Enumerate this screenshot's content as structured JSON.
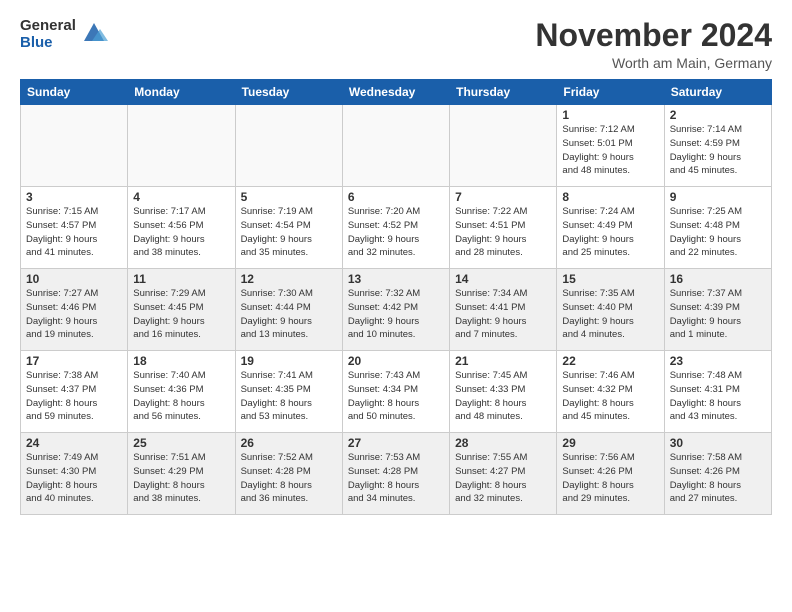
{
  "logo": {
    "general": "General",
    "blue": "Blue"
  },
  "title": "November 2024",
  "subtitle": "Worth am Main, Germany",
  "headers": [
    "Sunday",
    "Monday",
    "Tuesday",
    "Wednesday",
    "Thursday",
    "Friday",
    "Saturday"
  ],
  "weeks": [
    [
      {
        "day": "",
        "info": ""
      },
      {
        "day": "",
        "info": ""
      },
      {
        "day": "",
        "info": ""
      },
      {
        "day": "",
        "info": ""
      },
      {
        "day": "",
        "info": ""
      },
      {
        "day": "1",
        "info": "Sunrise: 7:12 AM\nSunset: 5:01 PM\nDaylight: 9 hours\nand 48 minutes."
      },
      {
        "day": "2",
        "info": "Sunrise: 7:14 AM\nSunset: 4:59 PM\nDaylight: 9 hours\nand 45 minutes."
      }
    ],
    [
      {
        "day": "3",
        "info": "Sunrise: 7:15 AM\nSunset: 4:57 PM\nDaylight: 9 hours\nand 41 minutes."
      },
      {
        "day": "4",
        "info": "Sunrise: 7:17 AM\nSunset: 4:56 PM\nDaylight: 9 hours\nand 38 minutes."
      },
      {
        "day": "5",
        "info": "Sunrise: 7:19 AM\nSunset: 4:54 PM\nDaylight: 9 hours\nand 35 minutes."
      },
      {
        "day": "6",
        "info": "Sunrise: 7:20 AM\nSunset: 4:52 PM\nDaylight: 9 hours\nand 32 minutes."
      },
      {
        "day": "7",
        "info": "Sunrise: 7:22 AM\nSunset: 4:51 PM\nDaylight: 9 hours\nand 28 minutes."
      },
      {
        "day": "8",
        "info": "Sunrise: 7:24 AM\nSunset: 4:49 PM\nDaylight: 9 hours\nand 25 minutes."
      },
      {
        "day": "9",
        "info": "Sunrise: 7:25 AM\nSunset: 4:48 PM\nDaylight: 9 hours\nand 22 minutes."
      }
    ],
    [
      {
        "day": "10",
        "info": "Sunrise: 7:27 AM\nSunset: 4:46 PM\nDaylight: 9 hours\nand 19 minutes."
      },
      {
        "day": "11",
        "info": "Sunrise: 7:29 AM\nSunset: 4:45 PM\nDaylight: 9 hours\nand 16 minutes."
      },
      {
        "day": "12",
        "info": "Sunrise: 7:30 AM\nSunset: 4:44 PM\nDaylight: 9 hours\nand 13 minutes."
      },
      {
        "day": "13",
        "info": "Sunrise: 7:32 AM\nSunset: 4:42 PM\nDaylight: 9 hours\nand 10 minutes."
      },
      {
        "day": "14",
        "info": "Sunrise: 7:34 AM\nSunset: 4:41 PM\nDaylight: 9 hours\nand 7 minutes."
      },
      {
        "day": "15",
        "info": "Sunrise: 7:35 AM\nSunset: 4:40 PM\nDaylight: 9 hours\nand 4 minutes."
      },
      {
        "day": "16",
        "info": "Sunrise: 7:37 AM\nSunset: 4:39 PM\nDaylight: 9 hours\nand 1 minute."
      }
    ],
    [
      {
        "day": "17",
        "info": "Sunrise: 7:38 AM\nSunset: 4:37 PM\nDaylight: 8 hours\nand 59 minutes."
      },
      {
        "day": "18",
        "info": "Sunrise: 7:40 AM\nSunset: 4:36 PM\nDaylight: 8 hours\nand 56 minutes."
      },
      {
        "day": "19",
        "info": "Sunrise: 7:41 AM\nSunset: 4:35 PM\nDaylight: 8 hours\nand 53 minutes."
      },
      {
        "day": "20",
        "info": "Sunrise: 7:43 AM\nSunset: 4:34 PM\nDaylight: 8 hours\nand 50 minutes."
      },
      {
        "day": "21",
        "info": "Sunrise: 7:45 AM\nSunset: 4:33 PM\nDaylight: 8 hours\nand 48 minutes."
      },
      {
        "day": "22",
        "info": "Sunrise: 7:46 AM\nSunset: 4:32 PM\nDaylight: 8 hours\nand 45 minutes."
      },
      {
        "day": "23",
        "info": "Sunrise: 7:48 AM\nSunset: 4:31 PM\nDaylight: 8 hours\nand 43 minutes."
      }
    ],
    [
      {
        "day": "24",
        "info": "Sunrise: 7:49 AM\nSunset: 4:30 PM\nDaylight: 8 hours\nand 40 minutes."
      },
      {
        "day": "25",
        "info": "Sunrise: 7:51 AM\nSunset: 4:29 PM\nDaylight: 8 hours\nand 38 minutes."
      },
      {
        "day": "26",
        "info": "Sunrise: 7:52 AM\nSunset: 4:28 PM\nDaylight: 8 hours\nand 36 minutes."
      },
      {
        "day": "27",
        "info": "Sunrise: 7:53 AM\nSunset: 4:28 PM\nDaylight: 8 hours\nand 34 minutes."
      },
      {
        "day": "28",
        "info": "Sunrise: 7:55 AM\nSunset: 4:27 PM\nDaylight: 8 hours\nand 32 minutes."
      },
      {
        "day": "29",
        "info": "Sunrise: 7:56 AM\nSunset: 4:26 PM\nDaylight: 8 hours\nand 29 minutes."
      },
      {
        "day": "30",
        "info": "Sunrise: 7:58 AM\nSunset: 4:26 PM\nDaylight: 8 hours\nand 27 minutes."
      }
    ]
  ]
}
